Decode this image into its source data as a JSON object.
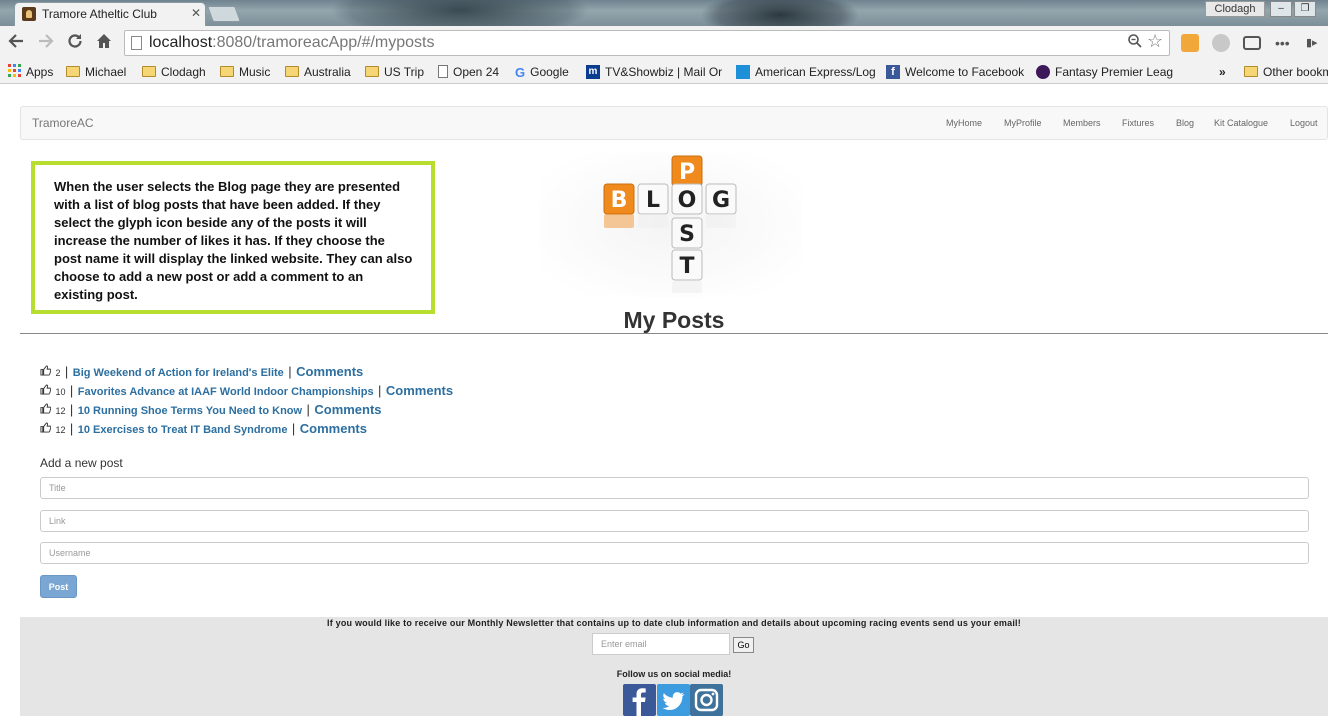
{
  "browser": {
    "tab_title": "Tramore Atheltic Club",
    "tab_close": "✕",
    "user": "Clodagh",
    "url_host": "localhost",
    "url_rest": ":8080/tramoreacApp/#/myposts",
    "bookmarks": [
      {
        "label": "Apps",
        "icon": "apps-grid-icon"
      },
      {
        "label": "Michael",
        "icon": "folder-icon"
      },
      {
        "label": "Clodagh",
        "icon": "folder-icon"
      },
      {
        "label": "Music",
        "icon": "folder-icon"
      },
      {
        "label": "Australia",
        "icon": "folder-icon"
      },
      {
        "label": "US Trip",
        "icon": "folder-icon"
      },
      {
        "label": "Open 24",
        "icon": "page-icon"
      },
      {
        "label": "Google",
        "icon": "google-icon"
      },
      {
        "label": "TV&Showbiz | Mail Or",
        "icon": "mail-online-icon"
      },
      {
        "label": "American Express/Log",
        "icon": "amex-icon"
      },
      {
        "label": "Welcome to Facebook",
        "icon": "facebook-icon"
      },
      {
        "label": "Fantasy Premier Leag",
        "icon": "premier-league-icon"
      }
    ],
    "more_bookmarks": "»",
    "other_bookmarks": "Other bookm"
  },
  "navbar": {
    "brand": "TramoreAC",
    "links": [
      "MyHome",
      "MyProfile",
      "Members",
      "Fixtures",
      "Blog",
      "Kit Catalogue",
      "Logout"
    ]
  },
  "callout": {
    "text": "When the user selects the Blog page they are presented with a list of blog posts that have been added. If they select the glyph icon beside any of the posts it will increase the number of likes it has. If they choose the post name it will display the linked website. They can also choose to add a new post or add a comment to an existing post."
  },
  "logo": {
    "letters_row": [
      "B",
      "L",
      "O",
      "G"
    ],
    "letters_col": [
      "P",
      "O",
      "S",
      "T"
    ]
  },
  "page": {
    "title": "My Posts",
    "separator": "|",
    "posts": [
      {
        "likes": "2",
        "title": "Big Weekend of Action for Ireland's Elite",
        "comments": "Comments"
      },
      {
        "likes": "10",
        "title": "Favorites Advance at IAAF World Indoor Championships",
        "comments": "Comments"
      },
      {
        "likes": "12",
        "title": "10 Running Shoe Terms You Need to Know",
        "comments": "Comments"
      },
      {
        "likes": "12",
        "title": "10 Exercises to Treat IT Band Syndrome",
        "comments": "Comments"
      }
    ],
    "add_post_label": "Add a new post",
    "title_placeholder": "Title",
    "link_placeholder": "Link",
    "username_placeholder": "Username",
    "post_button": "Post"
  },
  "footer": {
    "newsletter_text": "If you would like to receive our Monthly Newsletter that contains up to date club information and details about upcoming racing events send us your email!",
    "email_placeholder": "Enter email",
    "go_button": "Go",
    "follow_text": "Follow us on social media!",
    "social": [
      "facebook-icon",
      "twitter-icon",
      "instagram-icon"
    ]
  },
  "colors": {
    "link": "#2c6fa0",
    "callout_border": "#b7dd2e",
    "post_button": "#7aa6d3",
    "logo_orange": "#f08a1c"
  }
}
